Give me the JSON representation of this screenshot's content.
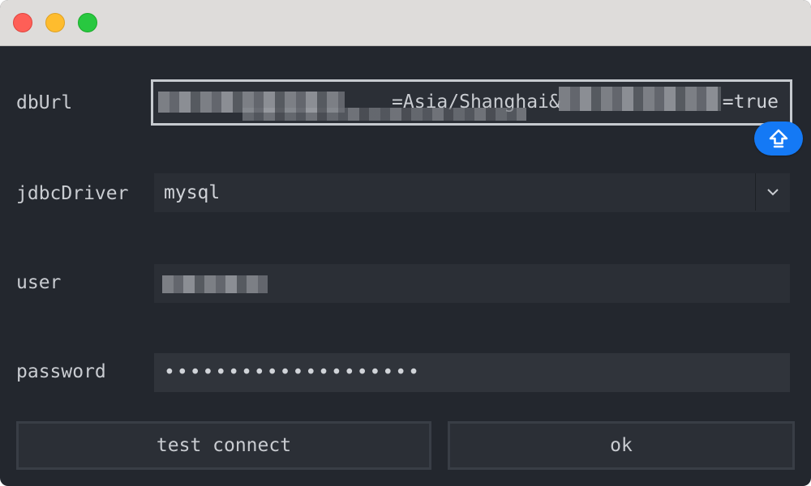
{
  "window": {
    "traffic_lights": [
      "close",
      "minimize",
      "zoom"
    ]
  },
  "form": {
    "dburl": {
      "label": "dbUrl",
      "value_visible": "=Asia/Shanghai&",
      "value_tail": "=true"
    },
    "jdbc_driver": {
      "label": "jdbcDriver",
      "value": "mysql",
      "icon": "chevron-down-icon"
    },
    "user": {
      "label": "user"
    },
    "password": {
      "label": "password",
      "value": "••••••••••••••••••••"
    }
  },
  "upload_button": {
    "icon": "arrow-up-icon",
    "color": "#1479f5"
  },
  "buttons": {
    "test_connect": "test connect",
    "ok": "ok"
  }
}
